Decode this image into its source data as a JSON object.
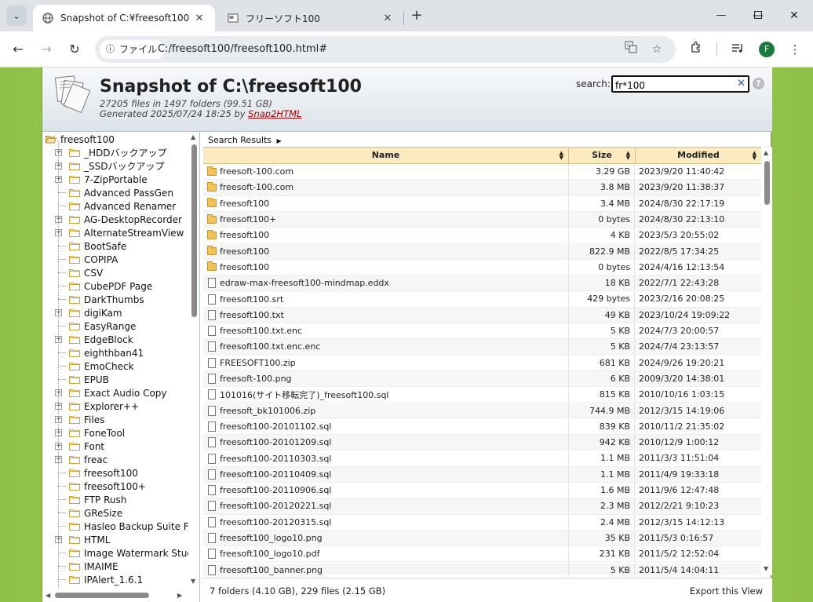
{
  "browser": {
    "tabs": [
      {
        "title": "Snapshot of C:¥freesoft100",
        "active": true
      },
      {
        "title": "フリーソフト100",
        "active": false
      }
    ],
    "address_chip": "ファイル",
    "url": "C:/freesoft100/freesoft100.html#",
    "profile_initial": "F"
  },
  "app": {
    "title": "Snapshot of C:\\freesoft100",
    "stats": "27205 files in 1497 folders (99.51 GB)",
    "generated_prefix": "Generated 2025/07/24 18:25 by",
    "generator_link": "Snap2HTML",
    "search_label": "search:",
    "search_value": "fr*100",
    "help": "?"
  },
  "tree": {
    "root": "freesoft100",
    "items": [
      {
        "label": "_HDDバックアップ",
        "expandable": true
      },
      {
        "label": "_SSDバックアップ",
        "expandable": true
      },
      {
        "label": "7-ZipPortable",
        "expandable": true
      },
      {
        "label": "Advanced PassGen",
        "expandable": false
      },
      {
        "label": "Advanced Renamer",
        "expandable": false
      },
      {
        "label": "AG-DesktopRecorder",
        "expandable": true
      },
      {
        "label": "AlternateStreamView",
        "expandable": true
      },
      {
        "label": "BootSafe",
        "expandable": false
      },
      {
        "label": "COPIPA",
        "expandable": false
      },
      {
        "label": "CSV",
        "expandable": false
      },
      {
        "label": "CubePDF Page",
        "expandable": false
      },
      {
        "label": "DarkThumbs",
        "expandable": false
      },
      {
        "label": "digiKam",
        "expandable": true
      },
      {
        "label": "EasyRange",
        "expandable": false
      },
      {
        "label": "EdgeBlock",
        "expandable": true
      },
      {
        "label": "eighthban41",
        "expandable": false
      },
      {
        "label": "EmoCheck",
        "expandable": false
      },
      {
        "label": "EPUB",
        "expandable": false
      },
      {
        "label": "Exact Audio Copy",
        "expandable": true
      },
      {
        "label": "Explorer++",
        "expandable": true
      },
      {
        "label": "Files",
        "expandable": true
      },
      {
        "label": "FoneTool",
        "expandable": true
      },
      {
        "label": "Font",
        "expandable": true
      },
      {
        "label": "freac",
        "expandable": true
      },
      {
        "label": "freesoft100",
        "expandable": false
      },
      {
        "label": "freesoft100+",
        "expandable": false
      },
      {
        "label": "FTP Rush",
        "expandable": false
      },
      {
        "label": "GReSize",
        "expandable": false
      },
      {
        "label": "Hasleo Backup Suite Fre",
        "expandable": false
      },
      {
        "label": "HTML",
        "expandable": true
      },
      {
        "label": "Image Watermark Studi",
        "expandable": false
      },
      {
        "label": "IMAIME",
        "expandable": false
      },
      {
        "label": "IPAlert_1.6.1",
        "expandable": false
      }
    ]
  },
  "results": {
    "breadcrumb": "Search Results",
    "columns": {
      "name": "Name",
      "size": "Size",
      "modified": "Modified"
    },
    "rows": [
      {
        "type": "folder",
        "name": "freesoft-100.com",
        "size": "3.29 GB",
        "modified": "2023/9/20 11:40:42"
      },
      {
        "type": "folder",
        "name": "freesoft-100.com",
        "size": "3.8 MB",
        "modified": "2023/9/20 11:38:37"
      },
      {
        "type": "folder",
        "name": "freesoft100",
        "size": "3.4 MB",
        "modified": "2024/8/30 22:17:19"
      },
      {
        "type": "folder",
        "name": "freesoft100+",
        "size": "0 bytes",
        "modified": "2024/8/30 22:13:10"
      },
      {
        "type": "folder",
        "name": "freesoft100",
        "size": "4 KB",
        "modified": "2023/5/3 20:55:02"
      },
      {
        "type": "folder",
        "name": "freesoft100",
        "size": "822.9 MB",
        "modified": "2022/8/5 17:34:25"
      },
      {
        "type": "folder",
        "name": "freesoft100",
        "size": "0 bytes",
        "modified": "2024/4/16 12:13:54"
      },
      {
        "type": "file",
        "name": "edraw-max-freesoft100-mindmap.eddx",
        "size": "18 KB",
        "modified": "2022/7/1 22:43:28"
      },
      {
        "type": "file",
        "name": "freesoft100.srt",
        "size": "429 bytes",
        "modified": "2023/2/16 20:08:25"
      },
      {
        "type": "file",
        "name": "freesoft100.txt",
        "size": "49 KB",
        "modified": "2023/10/24 19:09:22"
      },
      {
        "type": "file",
        "name": "freesoft100.txt.enc",
        "size": "5 KB",
        "modified": "2024/7/3 20:00:57"
      },
      {
        "type": "file",
        "name": "freesoft100.txt.enc.enc",
        "size": "5 KB",
        "modified": "2024/7/4 23:13:57"
      },
      {
        "type": "file",
        "name": "FREESOFT100.zip",
        "size": "681 KB",
        "modified": "2024/9/26 19:20:21"
      },
      {
        "type": "file",
        "name": "freesoft-100.png",
        "size": "6 KB",
        "modified": "2009/3/20 14:38:01"
      },
      {
        "type": "file",
        "name": "101016(サイト移転完了)_freesoft100.sql",
        "size": "815 KB",
        "modified": "2010/10/16 1:03:15"
      },
      {
        "type": "file",
        "name": "freesoft_bk101006.zip",
        "size": "744.9 MB",
        "modified": "2012/3/15 14:19:06"
      },
      {
        "type": "file",
        "name": "freesoft100-20101102.sql",
        "size": "839 KB",
        "modified": "2010/11/2 21:35:02"
      },
      {
        "type": "file",
        "name": "freesoft100-20101209.sql",
        "size": "942 KB",
        "modified": "2010/12/9 1:00:12"
      },
      {
        "type": "file",
        "name": "freesoft100-20110303.sql",
        "size": "1.1 MB",
        "modified": "2011/3/3 11:51:04"
      },
      {
        "type": "file",
        "name": "freesoft100-20110409.sql",
        "size": "1.1 MB",
        "modified": "2011/4/9 19:33:18"
      },
      {
        "type": "file",
        "name": "freesoft100-20110906.sql",
        "size": "1.6 MB",
        "modified": "2011/9/6 12:47:48"
      },
      {
        "type": "file",
        "name": "freesoft100-20120221.sql",
        "size": "2.3 MB",
        "modified": "2012/2/21 9:10:23"
      },
      {
        "type": "file",
        "name": "freesoft100-20120315.sql",
        "size": "2.4 MB",
        "modified": "2012/3/15 14:12:13"
      },
      {
        "type": "file",
        "name": "freesoft100_logo10.png",
        "size": "35 KB",
        "modified": "2011/5/3 0:16:57"
      },
      {
        "type": "file",
        "name": "freesoft100_logo10.pdf",
        "size": "231 KB",
        "modified": "2011/5/2 12:52:04"
      },
      {
        "type": "file",
        "name": "freesoft100_banner.png",
        "size": "5 KB",
        "modified": "2011/5/4 14:04:11"
      }
    ],
    "status": "7 folders (4.10 GB), 229 files (2.15 GB)",
    "export_label": "Export this View"
  },
  "colors": {
    "page_bg": "#a5d05d",
    "grid_header": "#fbe9bf",
    "folder_icon": "#f2c35a",
    "profile": "#1c7a3c",
    "link": "#aa0000"
  }
}
